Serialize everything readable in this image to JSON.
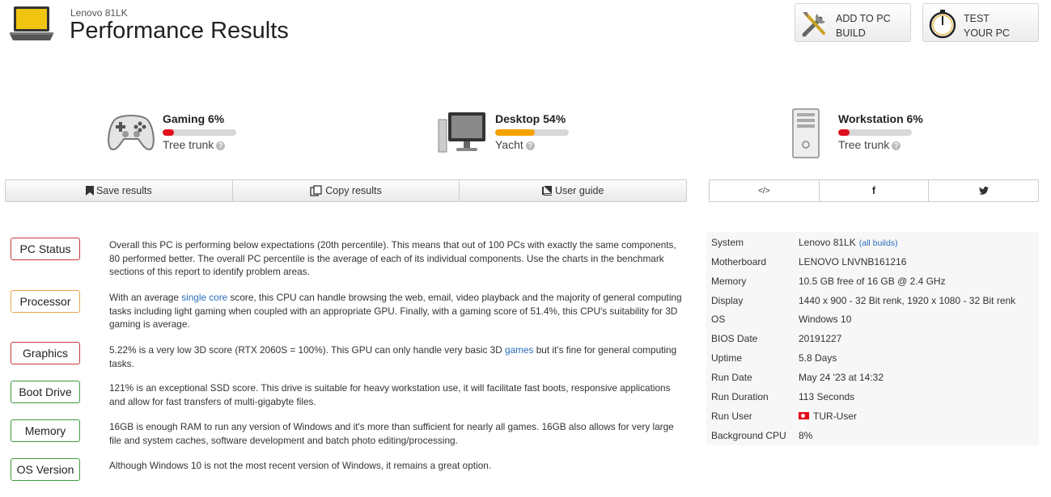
{
  "header": {
    "device": "Lenovo 81LK",
    "title": "Performance Results",
    "add_pc_label_1": "ADD TO PC",
    "add_pc_label_2": "BUILD",
    "test_pc_label_1": "TEST",
    "test_pc_label_2": "YOUR PC"
  },
  "categories": [
    {
      "name": "Gaming 6%",
      "rank": "Tree trunk",
      "percent": 6,
      "color": "#e0101e",
      "icon": "gamepad-icon"
    },
    {
      "name": "Desktop 54%",
      "rank": "Yacht",
      "percent": 54,
      "color": "#f5a300",
      "icon": "monitor-icon"
    },
    {
      "name": "Workstation 6%",
      "rank": "Tree trunk",
      "percent": 6,
      "color": "#e0101e",
      "icon": "tower-icon"
    }
  ],
  "actions": {
    "save": "Save results",
    "copy": "Copy results",
    "guide": "User guide"
  },
  "share": {
    "embed": "</>",
    "facebook": "f",
    "twitter": "twitter-icon"
  },
  "status": [
    {
      "tag": "PC Status",
      "color": "red",
      "text": "Overall this PC is performing below expectations (20th percentile). This means that out of 100 PCs with exactly the same components, 80 performed better. The overall PC percentile is the average of each of its individual components. Use the charts in the benchmark sections of this report to identify problem areas."
    },
    {
      "tag": "Processor",
      "color": "orange",
      "text_pre": "With an average ",
      "link": "single core",
      "text_post": " score, this CPU can handle browsing the web, email, video playback and the majority of general computing tasks including light gaming when coupled with an appropriate GPU. Finally, with a gaming score of 51.4%, this CPU's suitability for 3D gaming is average."
    },
    {
      "tag": "Graphics",
      "color": "red",
      "text_pre": "5.22% is a very low 3D score (RTX 2060S = 100%). This GPU can only handle very basic 3D ",
      "link": "games",
      "text_post": " but it's fine for general computing tasks."
    },
    {
      "tag": "Boot Drive",
      "color": "green",
      "text": "121% is an exceptional SSD score. This drive is suitable for heavy workstation use, it will facilitate fast boots, responsive applications and allow for fast transfers of multi-gigabyte files."
    },
    {
      "tag": "Memory",
      "color": "green",
      "text": "16GB is enough RAM to run any version of Windows and it's more than sufficient for nearly all games. 16GB also allows for very large file and system caches, software development and batch photo editing/processing."
    },
    {
      "tag": "OS Version",
      "color": "green",
      "text": "Although Windows 10 is not the most recent version of Windows, it remains a great option."
    }
  ],
  "system_info": {
    "system_label": "System",
    "system_value": "Lenovo 81LK",
    "all_builds": "(all builds)",
    "motherboard_label": "Motherboard",
    "motherboard_value": "LENOVO LNVNB161216",
    "memory_label": "Memory",
    "memory_value": "10.5 GB free of 16 GB @ 2.4 GHz",
    "display_label": "Display",
    "display_value": "1440 x 900 - 32 Bit renk, 1920 x 1080 - 32 Bit renk",
    "os_label": "OS",
    "os_value": "Windows 10",
    "bios_label": "BIOS Date",
    "bios_value": "20191227",
    "uptime_label": "Uptime",
    "uptime_value": "5.8 Days",
    "run_date_label": "Run Date",
    "run_date_value": "May 24 '23 at 14:32",
    "run_duration_label": "Run Duration",
    "run_duration_value": "113 Seconds",
    "run_user_label": "Run User",
    "run_user_value": "TUR-User",
    "bg_cpu_label": "Background CPU",
    "bg_cpu_value": "8%"
  }
}
